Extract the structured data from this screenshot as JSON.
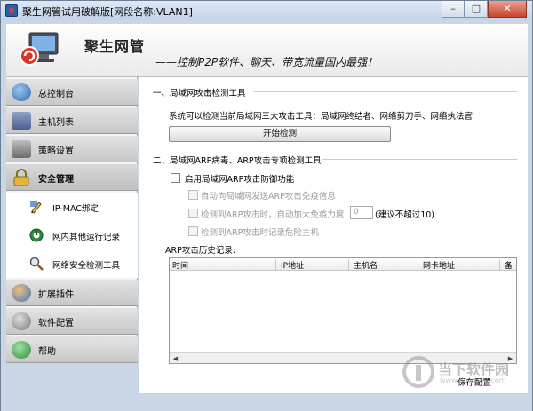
{
  "window": {
    "title": "聚生网管试用破解版[网段名称:VLAN1]",
    "buttons": {
      "minimize": "–",
      "maximize": "□",
      "close": "✕"
    }
  },
  "banner": {
    "title": "聚生网管",
    "slogan": "——控制P2P软件、聊天、带宽流量国内最强！"
  },
  "sidebar": {
    "items": [
      {
        "label": "总控制台",
        "icon": "globe-console-icon",
        "color": "#2f67b3"
      },
      {
        "label": "主机列表",
        "icon": "host-list-icon",
        "color": "#5b6e9a"
      },
      {
        "label": "策略设置",
        "icon": "policy-icon",
        "color": "#6c6c6c"
      },
      {
        "label": "安全管理",
        "icon": "lock-icon",
        "color": "#d9a62b"
      }
    ],
    "sub_items": [
      {
        "label": "IP-MAC绑定",
        "icon": "pen-icon"
      },
      {
        "label": "网内其他运行记录",
        "icon": "record-icon"
      },
      {
        "label": "网络安全检测工具",
        "icon": "magnifier-icon"
      }
    ],
    "bottom_items": [
      {
        "label": "扩展插件",
        "icon": "plugin-icon",
        "color": "#3b74c4"
      },
      {
        "label": "软件配置",
        "icon": "config-icon",
        "color": "#777777"
      },
      {
        "label": "帮助",
        "icon": "help-icon",
        "color": "#2e8d3a"
      }
    ]
  },
  "main": {
    "section1": {
      "heading": "一、局域网攻击检测工具",
      "description": "系统可以检测当前局域网三大攻击工具：局域网终结者、网络剪刀手、网络执法官",
      "start_button": "开始检测"
    },
    "section2": {
      "heading": "二、局域网ARP病毒、ARP攻击专项检测工具",
      "enable_label": "启用局域网ARP攻击防御功能",
      "opt1": "自动向局域网发送ARP攻击免疫信息",
      "opt2_prefix": "检测到ARP攻击时，自动加大免疫力度",
      "opt2_value": "0",
      "opt2_suffix": "(建议不超过10)",
      "opt3": "检测到ARP攻击时记录危险主机",
      "history_label": "ARP攻击历史记录:",
      "columns": [
        "时间",
        "IP地址",
        "主机名",
        "网卡地址",
        "备"
      ],
      "save_button": "保存配置"
    }
  },
  "watermark": {
    "title": "当下软件园",
    "url": "www.downxia.com"
  },
  "colors": {
    "accent": "#2b5fa8",
    "chrome": "#c9d6e6"
  }
}
